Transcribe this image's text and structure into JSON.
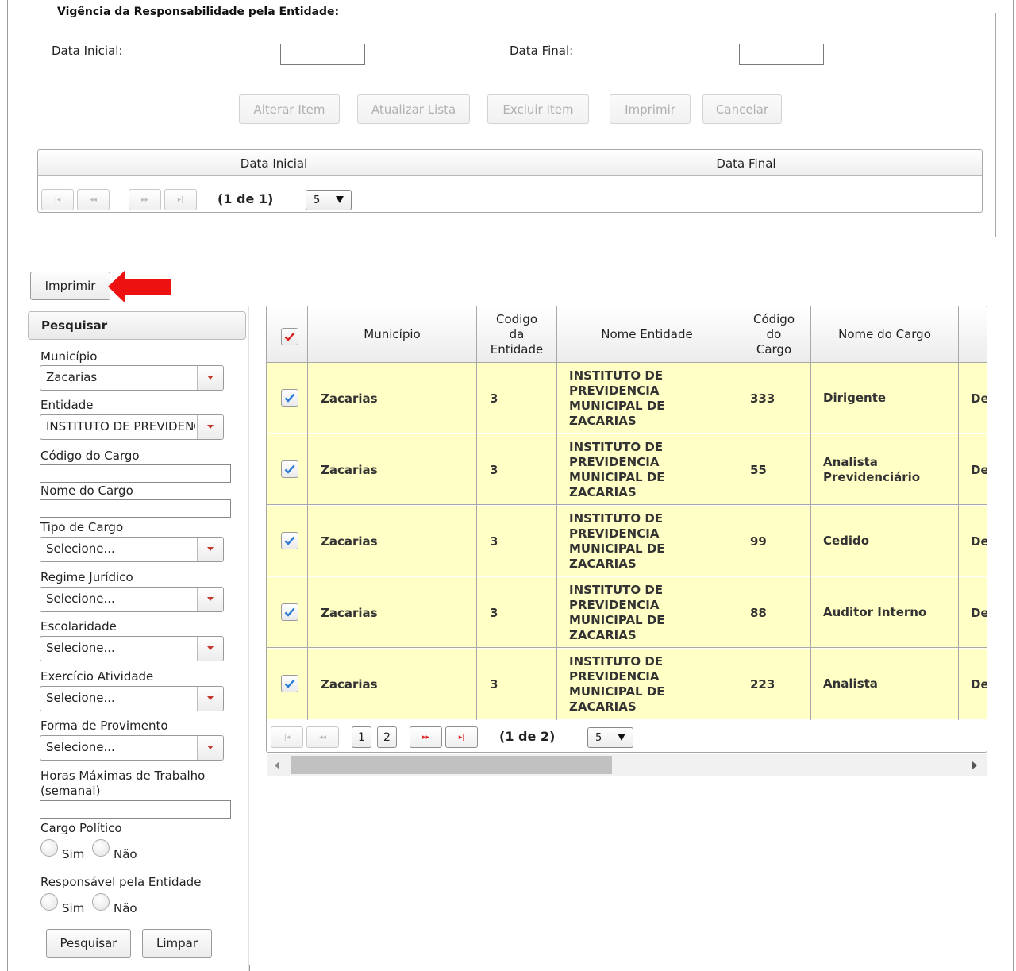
{
  "vigencia": {
    "legend": "Vigência da Responsabilidade pela Entidade:",
    "data_inicial_label": "Data Inicial:",
    "data_final_label": "Data Final:",
    "data_inicial_value": "",
    "data_final_value": "",
    "buttons": {
      "alterar": "Alterar Item",
      "atualizar": "Atualizar Lista",
      "excluir": "Excluir Item",
      "imprimir": "Imprimir",
      "cancelar": "Cancelar"
    },
    "table": {
      "col_inicial": "Data Inicial",
      "col_final": "Data Final",
      "page_info": "(1 de 1)",
      "page_size": "5"
    }
  },
  "print_button": "Imprimir",
  "search": {
    "header": "Pesquisar",
    "municipio_label": "Município",
    "municipio_value": "Zacarias",
    "entidade_label": "Entidade",
    "entidade_value": "INSTITUTO DE PREVIDENCIA",
    "codigo_cargo_label": "Código do Cargo",
    "nome_cargo_label": "Nome do Cargo",
    "tipo_cargo_label": "Tipo de Cargo",
    "tipo_cargo_value": "Selecione...",
    "regime_label": "Regime Jurídico",
    "regime_value": "Selecione...",
    "escolaridade_label": "Escolaridade",
    "escolaridade_value": "Selecione...",
    "exercicio_label": "Exercício Atividade",
    "exercicio_value": "Selecione...",
    "provimento_label": "Forma de Provimento",
    "provimento_value": "Selecione...",
    "horas_label_1": "Horas Máximas de Trabalho",
    "horas_label_2": "(semanal)",
    "politico_label": "Cargo Político",
    "responsavel_label": "Responsável pela Entidade",
    "sim": "Sim",
    "nao": "Não",
    "btn_pesquisar": "Pesquisar",
    "btn_limpar": "Limpar"
  },
  "grid": {
    "headers": {
      "municipio": "Município",
      "codigo_entidade_1": "Codigo",
      "codigo_entidade_2": "da",
      "codigo_entidade_3": "Entidade",
      "nome_entidade": "Nome Entidade",
      "codigo_cargo_1": "Código",
      "codigo_cargo_2": "do",
      "codigo_cargo_3": "Cargo",
      "nome_cargo": "Nome do Cargo"
    },
    "rows": [
      {
        "municipio": "Zacarias",
        "cod_ent": "3",
        "ent1": "INSTITUTO DE",
        "ent2": "PREVIDENCIA",
        "ent3": "MUNICIPAL DE",
        "ent4": "ZACARIAS",
        "cod_cargo": "333",
        "cargo1": "Dirigente",
        "cargo2": "",
        "extra": "De"
      },
      {
        "municipio": "Zacarias",
        "cod_ent": "3",
        "ent1": "INSTITUTO DE",
        "ent2": "PREVIDENCIA",
        "ent3": "MUNICIPAL DE",
        "ent4": "ZACARIAS",
        "cod_cargo": "55",
        "cargo1": "Analista",
        "cargo2": "Previdenciário",
        "extra": "De"
      },
      {
        "municipio": "Zacarias",
        "cod_ent": "3",
        "ent1": "INSTITUTO DE",
        "ent2": "PREVIDENCIA",
        "ent3": "MUNICIPAL DE",
        "ent4": "ZACARIAS",
        "cod_cargo": "99",
        "cargo1": "Cedido",
        "cargo2": "",
        "extra": "De"
      },
      {
        "municipio": "Zacarias",
        "cod_ent": "3",
        "ent1": "INSTITUTO DE",
        "ent2": "PREVIDENCIA",
        "ent3": "MUNICIPAL DE",
        "ent4": "ZACARIAS",
        "cod_cargo": "88",
        "cargo1": "Auditor Interno",
        "cargo2": "",
        "extra": "De"
      },
      {
        "municipio": "Zacarias",
        "cod_ent": "3",
        "ent1": "INSTITUTO DE",
        "ent2": "PREVIDENCIA",
        "ent3": "MUNICIPAL DE",
        "ent4": "ZACARIAS",
        "cod_cargo": "223",
        "cargo1": "Analista",
        "cargo2": "",
        "extra": "De"
      }
    ],
    "pages": [
      "1",
      "2"
    ],
    "page_info": "(1 de 2)",
    "page_size": "5"
  },
  "colors": {
    "row_bg": "#ffffc6",
    "accent_red": "#ee1111",
    "check_blue": "#2b7bd6"
  }
}
